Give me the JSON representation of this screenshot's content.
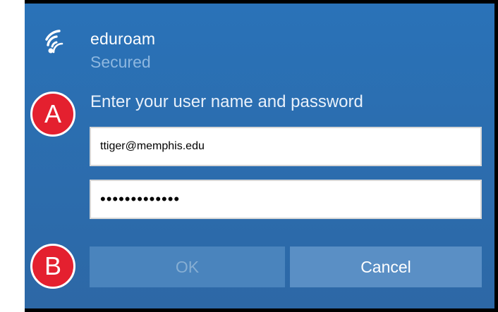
{
  "network": {
    "ssid": "eduroam",
    "security": "Secured",
    "icon": "wifi-secured-icon"
  },
  "form": {
    "prompt": "Enter your user name and password",
    "username_value": "ttiger@memphis.edu",
    "password_masked": "•••••••••••••"
  },
  "buttons": {
    "ok_label": "OK",
    "cancel_label": "Cancel"
  },
  "annotations": {
    "marker_a": "A",
    "marker_b": "B"
  },
  "colors": {
    "panel": "#2b6eb0",
    "marker": "#e4202f"
  }
}
